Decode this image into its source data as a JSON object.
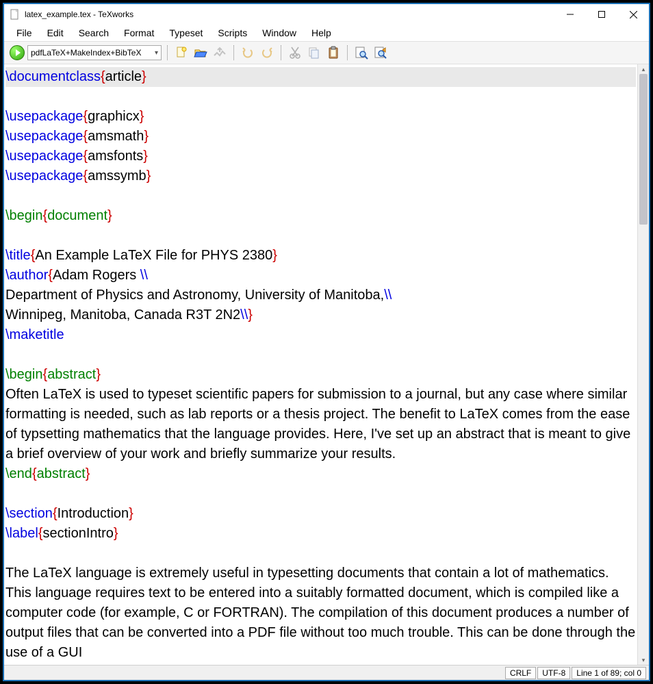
{
  "window": {
    "title": "latex_example.tex - TeXworks"
  },
  "menubar": [
    "File",
    "Edit",
    "Search",
    "Format",
    "Typeset",
    "Scripts",
    "Window",
    "Help"
  ],
  "toolbar": {
    "engine": "pdfLaTeX+MakeIndex+BibTeX"
  },
  "editor": {
    "lines": [
      {
        "type": "hl",
        "seg": [
          [
            "cs",
            "\\documentclass"
          ],
          [
            "delim",
            "{"
          ],
          [
            "txt",
            "article"
          ],
          [
            "delim",
            "}"
          ]
        ]
      },
      {
        "seg": [
          [
            "cs",
            "\\usepackage"
          ],
          [
            "delim",
            "{"
          ],
          [
            "txt",
            "graphicx"
          ],
          [
            "delim",
            "}"
          ]
        ]
      },
      {
        "seg": [
          [
            "cs",
            "\\usepackage"
          ],
          [
            "delim",
            "{"
          ],
          [
            "txt",
            "amsmath"
          ],
          [
            "delim",
            "}"
          ]
        ]
      },
      {
        "seg": [
          [
            "cs",
            "\\usepackage"
          ],
          [
            "delim",
            "{"
          ],
          [
            "txt",
            "amsfonts"
          ],
          [
            "delim",
            "}"
          ]
        ]
      },
      {
        "seg": [
          [
            "cs",
            "\\usepackage"
          ],
          [
            "delim",
            "{"
          ],
          [
            "txt",
            "amssymb"
          ],
          [
            "delim",
            "}"
          ]
        ]
      },
      {
        "seg": [
          [
            "txt",
            ""
          ]
        ]
      },
      {
        "seg": [
          [
            "env",
            "\\begin"
          ],
          [
            "delim",
            "{"
          ],
          [
            "env2",
            "document"
          ],
          [
            "delim",
            "}"
          ]
        ]
      },
      {
        "seg": [
          [
            "txt",
            ""
          ]
        ]
      },
      {
        "seg": [
          [
            "cs",
            "\\title"
          ],
          [
            "delim",
            "{"
          ],
          [
            "txt",
            "An Example LaTeX File for PHYS 2380"
          ],
          [
            "delim",
            "}"
          ]
        ]
      },
      {
        "seg": [
          [
            "cs",
            "\\author"
          ],
          [
            "delim",
            "{"
          ],
          [
            "txt",
            "Adam Rogers "
          ],
          [
            "cs",
            "\\\\"
          ]
        ]
      },
      {
        "seg": [
          [
            "txt",
            "Department of Physics and Astronomy, University of Manitoba,"
          ],
          [
            "cs",
            "\\\\"
          ]
        ]
      },
      {
        "seg": [
          [
            "txt",
            "Winnipeg, Manitoba, Canada R3T 2N2"
          ],
          [
            "cs",
            "\\\\"
          ],
          [
            "delim",
            "}"
          ]
        ]
      },
      {
        "seg": [
          [
            "cs",
            "\\maketitle"
          ]
        ]
      },
      {
        "seg": [
          [
            "txt",
            ""
          ]
        ]
      },
      {
        "seg": [
          [
            "env",
            "\\begin"
          ],
          [
            "delim",
            "{"
          ],
          [
            "env2",
            "abstract"
          ],
          [
            "delim",
            "}"
          ]
        ]
      },
      {
        "seg": [
          [
            "txt",
            "Often LaTeX is used to typeset scientific papers for submission to a journal, but any case where similar formatting is needed, such as lab reports or a thesis project. The benefit to LaTeX comes from the ease of typsetting mathematics that the language provides. Here, I've set up an abstract that is meant to give a brief overview of your work and briefly summarize your results."
          ]
        ]
      },
      {
        "seg": [
          [
            "env",
            "\\end"
          ],
          [
            "delim",
            "{"
          ],
          [
            "env2",
            "abstract"
          ],
          [
            "delim",
            "}"
          ]
        ]
      },
      {
        "seg": [
          [
            "txt",
            ""
          ]
        ]
      },
      {
        "seg": [
          [
            "cs",
            "\\section"
          ],
          [
            "delim",
            "{"
          ],
          [
            "txt",
            "Introduction"
          ],
          [
            "delim",
            "}"
          ]
        ]
      },
      {
        "seg": [
          [
            "cs",
            "\\label"
          ],
          [
            "delim",
            "{"
          ],
          [
            "txt",
            "sectionIntro"
          ],
          [
            "delim",
            "}"
          ]
        ]
      },
      {
        "seg": [
          [
            "txt",
            ""
          ]
        ]
      },
      {
        "seg": [
          [
            "txt",
            "The LaTeX language is extremely useful in typesetting documents that contain a lot of mathematics. This language requires text to be entered into a suitably formatted document, which is compiled like a computer code (for example, C or FORTRAN). The compilation of this document produces a number of output files that can be converted into a PDF file without too much trouble. This can be done through the use of a GUI"
          ]
        ]
      }
    ]
  },
  "statusbar": {
    "eol": "CRLF",
    "encoding": "UTF-8",
    "position": "Line 1 of 89; col 0"
  }
}
